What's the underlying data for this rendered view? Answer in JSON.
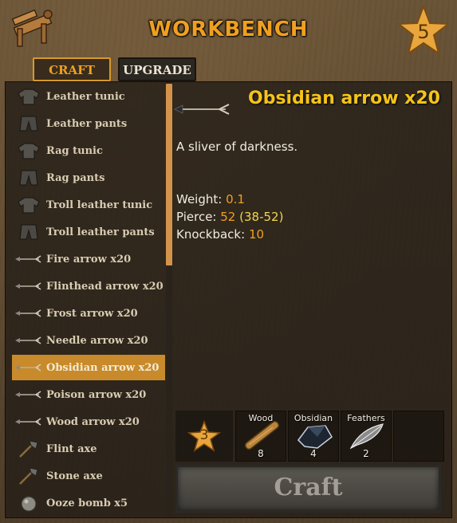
{
  "header": {
    "title": "WORKBENCH",
    "station_level": "5"
  },
  "tabs": [
    {
      "label": "CRAFT",
      "active": true
    },
    {
      "label": "UPGRADE",
      "active": false
    }
  ],
  "recipes": [
    {
      "label": "Leather tunic",
      "icon": "tunic-icon"
    },
    {
      "label": "Leather pants",
      "icon": "pants-icon"
    },
    {
      "label": "Rag tunic",
      "icon": "tunic-icon"
    },
    {
      "label": "Rag pants",
      "icon": "pants-icon"
    },
    {
      "label": "Troll leather tunic",
      "icon": "tunic-icon"
    },
    {
      "label": "Troll leather pants",
      "icon": "pants-icon"
    },
    {
      "label": "Fire arrow x20",
      "icon": "arrow-icon"
    },
    {
      "label": "Flinthead arrow x20",
      "icon": "arrow-icon"
    },
    {
      "label": "Frost arrow x20",
      "icon": "arrow-icon"
    },
    {
      "label": "Needle arrow x20",
      "icon": "arrow-icon"
    },
    {
      "label": "Obsidian arrow x20",
      "icon": "arrow-icon",
      "selected": true
    },
    {
      "label": "Poison arrow x20",
      "icon": "arrow-icon"
    },
    {
      "label": "Wood arrow x20",
      "icon": "arrow-icon"
    },
    {
      "label": "Flint axe",
      "icon": "axe-icon"
    },
    {
      "label": "Stone axe",
      "icon": "axe-icon"
    },
    {
      "label": "Ooze bomb x5",
      "icon": "bomb-icon"
    }
  ],
  "detail": {
    "title": "Obsidian arrow x20",
    "description": "A sliver of darkness.",
    "stats": {
      "weight_label": "Weight:",
      "weight_value": "0.1",
      "pierce_label": "Pierce:",
      "pierce_value": "52",
      "pierce_range": "(38-52)",
      "knockback_label": "Knockback:",
      "knockback_value": "10"
    }
  },
  "requirements": {
    "station_level": "3",
    "resources": [
      {
        "name": "Wood",
        "count": "8",
        "icon": "wood-icon"
      },
      {
        "name": "Obsidian",
        "count": "4",
        "icon": "obsidian-icon"
      },
      {
        "name": "Feathers",
        "count": "2",
        "icon": "feather-icon"
      }
    ]
  },
  "craft_button": {
    "label": "Craft"
  },
  "colors": {
    "accent": "#f0a020",
    "title": "#f5c418",
    "selected_row": "#c88a2a"
  }
}
